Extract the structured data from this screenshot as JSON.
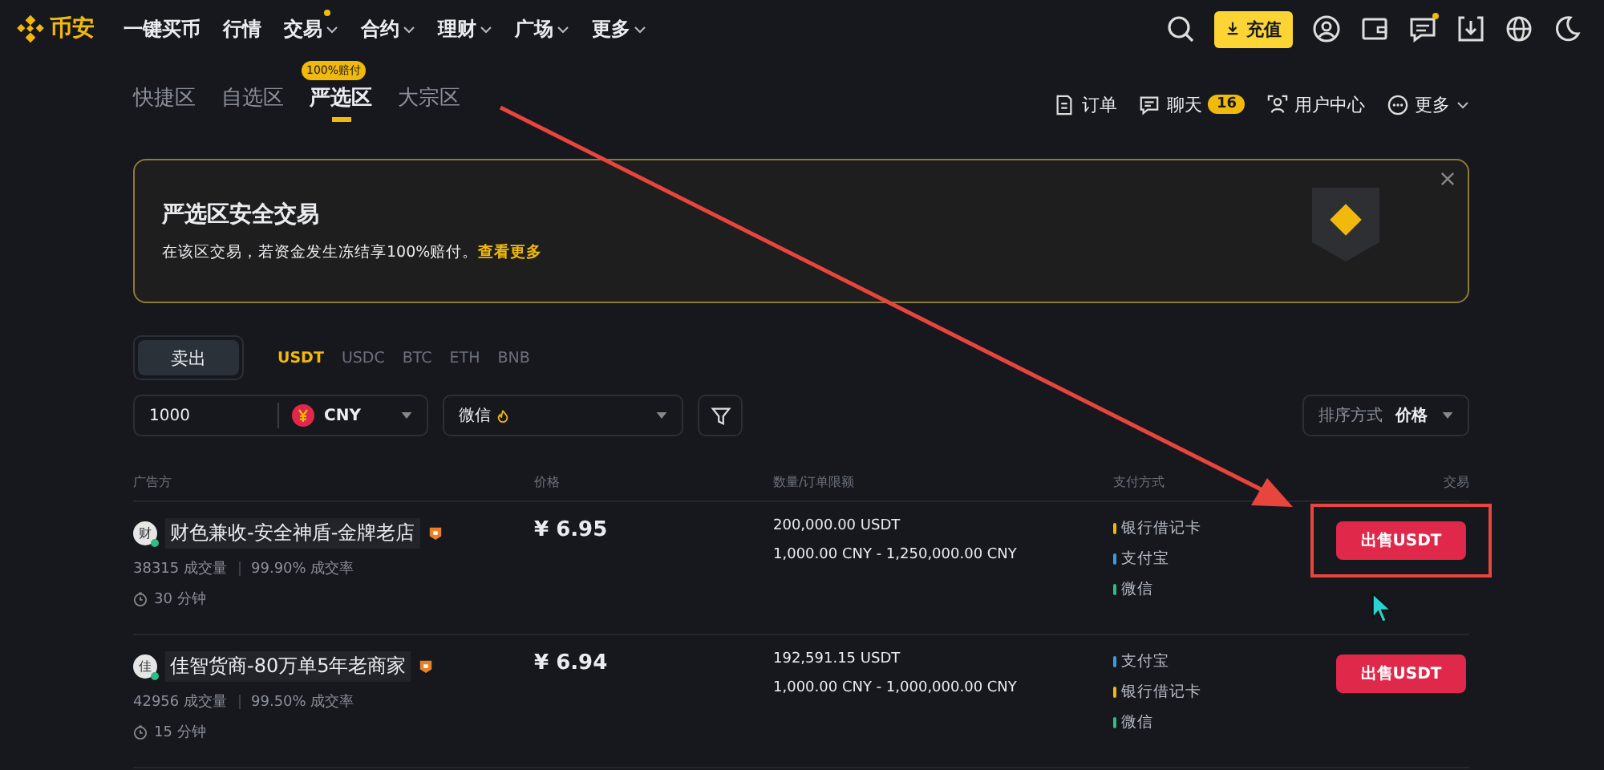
{
  "brand": {
    "name": "币安"
  },
  "nav": [
    {
      "label": "一键买币",
      "dropdown": false,
      "dot": false
    },
    {
      "label": "行情",
      "dropdown": false,
      "dot": false
    },
    {
      "label": "交易",
      "dropdown": true,
      "dot": true
    },
    {
      "label": "合约",
      "dropdown": true,
      "dot": false
    },
    {
      "label": "理财",
      "dropdown": true,
      "dot": false
    },
    {
      "label": "广场",
      "dropdown": true,
      "dot": false
    },
    {
      "label": "更多",
      "dropdown": true,
      "dot": false
    }
  ],
  "deposit_button": "充值",
  "header_icons": [
    {
      "kind": "search",
      "dot": false
    },
    {
      "kind": "deposit"
    },
    {
      "kind": "user",
      "dot": false
    },
    {
      "kind": "wallet",
      "dot": false
    },
    {
      "kind": "message",
      "dot": true
    },
    {
      "kind": "download",
      "dot": false
    },
    {
      "kind": "globe",
      "dot": false
    },
    {
      "kind": "moon",
      "dot": false
    }
  ],
  "zones": [
    {
      "label": "快捷区",
      "selected": false
    },
    {
      "label": "自选区",
      "selected": false
    },
    {
      "label": "严选区",
      "selected": true,
      "badge": "100%赔付"
    },
    {
      "label": "大宗区",
      "selected": false
    }
  ],
  "sub_links": [
    {
      "kind": "orders",
      "label": "订单"
    },
    {
      "kind": "chat",
      "label": "聊天",
      "badge": "16"
    },
    {
      "kind": "user_center",
      "label": "用户中心"
    },
    {
      "kind": "more",
      "label": "更多"
    }
  ],
  "banner": {
    "title": "严选区安全交易",
    "text": "在该区交易，若资金发生冻结享100%赔付。",
    "link": "查看更多"
  },
  "side_tabs": [
    {
      "label": "卖出",
      "selected": true
    }
  ],
  "coins": [
    {
      "label": "USDT",
      "selected": true
    },
    {
      "label": "USDC",
      "selected": false
    },
    {
      "label": "BTC",
      "selected": false
    },
    {
      "label": "ETH",
      "selected": false
    },
    {
      "label": "BNB",
      "selected": false
    }
  ],
  "filters": {
    "amount": "1000",
    "currency": "CNY",
    "payment": "微信",
    "sort_label": "排序方式",
    "sort_value": "价格"
  },
  "table": {
    "columns": [
      "广告方",
      "价格",
      "数量/订单限额",
      "支付方式",
      "交易"
    ],
    "rows": [
      {
        "avatar": "财",
        "name": "财色兼收-安全神盾-金牌老店",
        "trades": "38315 成交量",
        "rate": "99.90% 成交率",
        "time": "30 分钟",
        "price": "¥ 6.95",
        "amount": "200,000.00 USDT",
        "limit": "1,000.00 CNY - 1,250,000.00 CNY",
        "payments": [
          {
            "label": "银行借记卡",
            "color": "#f0b90b"
          },
          {
            "label": "支付宝",
            "color": "#3b9de0"
          },
          {
            "label": "微信",
            "color": "#2ebd85"
          }
        ],
        "action": "出售USDT",
        "highlighted": true
      },
      {
        "avatar": "佳",
        "name": "佳智货商-80万单5年老商家",
        "trades": "42956 成交量",
        "rate": "99.50% 成交率",
        "time": "15 分钟",
        "price": "¥ 6.94",
        "amount": "192,591.15 USDT",
        "limit": "1,000.00 CNY - 1,000,000.00 CNY",
        "payments": [
          {
            "label": "支付宝",
            "color": "#3b9de0"
          },
          {
            "label": "银行借记卡",
            "color": "#f0b90b"
          },
          {
            "label": "微信",
            "color": "#2ebd85"
          }
        ],
        "action": "出售USDT",
        "highlighted": false
      }
    ]
  }
}
